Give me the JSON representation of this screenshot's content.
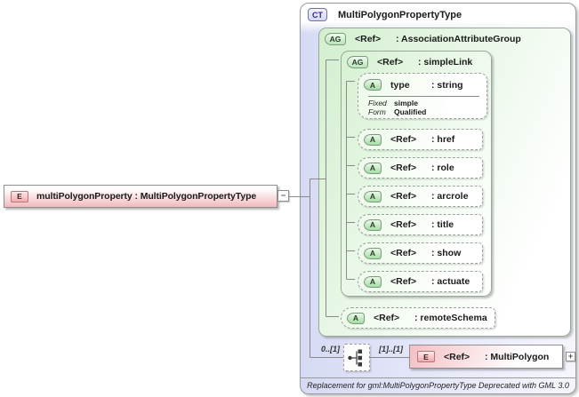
{
  "colors": {
    "lavender": "#d6daf4",
    "green": "#d3efcf",
    "pink": "#f2b9bd",
    "line": "#8a8a8a"
  },
  "left_element": {
    "badge": "E",
    "label": "multiPolygonProperty : MultiPolygonPropertyType",
    "collapse_glyph": "−"
  },
  "complex_type": {
    "badge": "CT",
    "title": "MultiPolygonPropertyType",
    "annotation": "Replacement for gml:MultiPolygonPropertyType Deprecated with GML 3.0"
  },
  "association_group": {
    "badge": "AG",
    "ref": "<Ref>",
    "name": ": AssociationAttributeGroup"
  },
  "simple_link": {
    "badge": "AG",
    "ref": "<Ref>",
    "name": ": simpleLink"
  },
  "type_attribute": {
    "badge": "A",
    "name": "type",
    "datatype": ": string",
    "facets": [
      {
        "label": "Fixed",
        "value": "simple"
      },
      {
        "label": "Form",
        "value": "Qualified"
      }
    ]
  },
  "link_attributes": [
    {
      "badge": "A",
      "ref": "<Ref>",
      "name": ": href"
    },
    {
      "badge": "A",
      "ref": "<Ref>",
      "name": ": role"
    },
    {
      "badge": "A",
      "ref": "<Ref>",
      "name": ": arcrole"
    },
    {
      "badge": "A",
      "ref": "<Ref>",
      "name": ": title"
    },
    {
      "badge": "A",
      "ref": "<Ref>",
      "name": ": show"
    },
    {
      "badge": "A",
      "ref": "<Ref>",
      "name": ": actuate"
    }
  ],
  "remote_schema": {
    "badge": "A",
    "ref": "<Ref>",
    "name": ": remoteSchema"
  },
  "sequence": {
    "cardinality_left": "0..[1]",
    "cardinality_right": "[1]..[1]"
  },
  "multi_polygon": {
    "badge": "E",
    "ref": "<Ref>",
    "name": ": MultiPolygon",
    "expand_glyph": "+"
  }
}
